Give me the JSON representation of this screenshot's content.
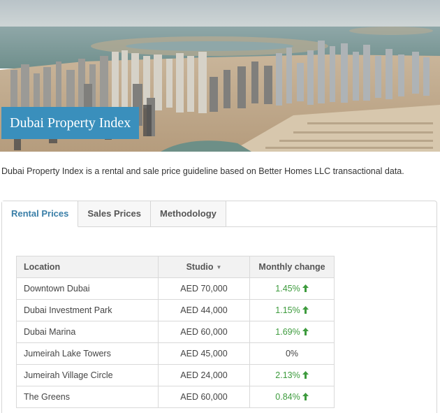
{
  "hero": {
    "title": "Dubai Property Index",
    "image": "dubai-skyline-aerial-photo"
  },
  "intro_text": "Dubai Property Index is a rental and sale price guideline based on Better Homes LLC transactional data.",
  "tabs": [
    {
      "label": "Rental Prices",
      "active": true
    },
    {
      "label": "Sales Prices",
      "active": false
    },
    {
      "label": "Methodology",
      "active": false
    }
  ],
  "table": {
    "headers": {
      "location": "Location",
      "studio": "Studio",
      "change": "Monthly change"
    },
    "sort_icon": "caret-down-icon",
    "rows": [
      {
        "location": "Downtown Dubai",
        "studio": "AED 70,000",
        "change": "1.45%",
        "trend": "up"
      },
      {
        "location": "Dubai Investment Park",
        "studio": "AED 44,000",
        "change": "1.15%",
        "trend": "up"
      },
      {
        "location": "Dubai Marina",
        "studio": "AED 60,000",
        "change": "1.69%",
        "trend": "up"
      },
      {
        "location": "Jumeirah Lake Towers",
        "studio": "AED 45,000",
        "change": "0%",
        "trend": "flat"
      },
      {
        "location": "Jumeirah Village Circle",
        "studio": "AED 24,000",
        "change": "2.13%",
        "trend": "up"
      },
      {
        "location": "The Greens",
        "studio": "AED 60,000",
        "change": "0.84%",
        "trend": "up"
      }
    ]
  },
  "colors": {
    "accent": "#3a8fbc",
    "tab_active": "#3a7fa8",
    "positive": "#3d9b3d"
  }
}
